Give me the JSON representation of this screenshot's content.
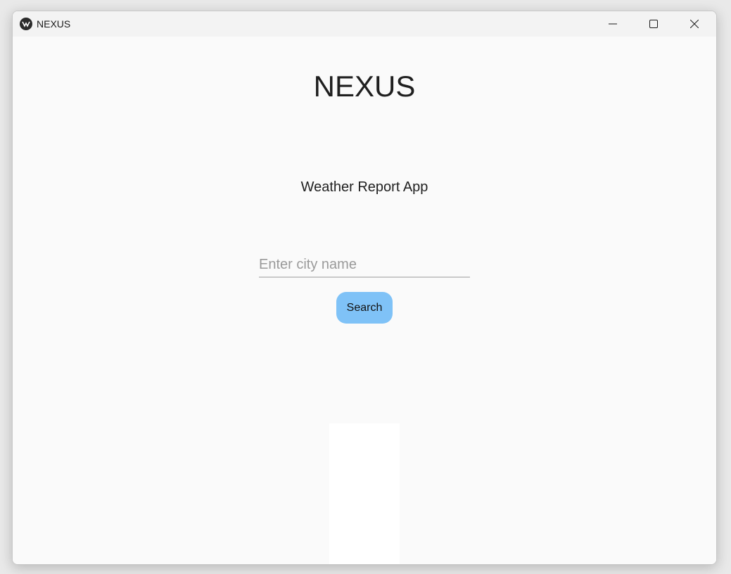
{
  "window": {
    "title": "NEXUS"
  },
  "main": {
    "heading": "NEXUS",
    "subtitle": "Weather Report App",
    "city_input": {
      "value": "",
      "placeholder": "Enter city name"
    },
    "search_button": {
      "label": "Search"
    }
  },
  "colors": {
    "button_background": "#7fc2f7",
    "content_background": "#fafafa",
    "titlebar_background": "#f3f3f3",
    "result_panel_background": "#ffffff"
  },
  "icons": {
    "app": "app-logo-icon",
    "minimize": "minimize-icon",
    "maximize": "maximize-icon",
    "close": "close-icon"
  }
}
